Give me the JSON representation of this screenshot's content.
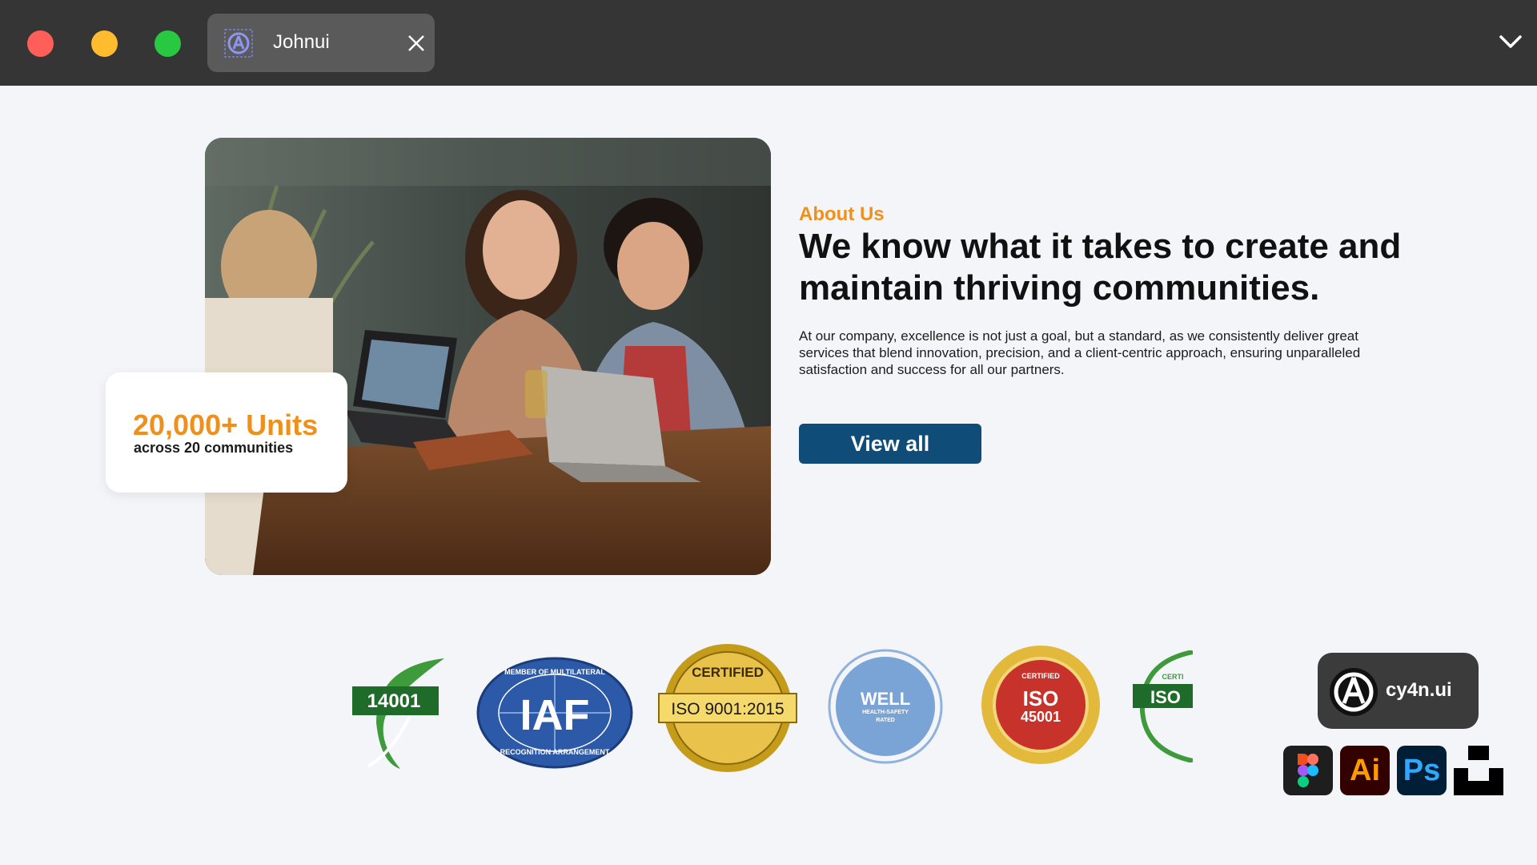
{
  "window": {
    "tab_title": "Johnui",
    "icons": [
      "app-logo-icon",
      "close-icon",
      "chevron-down-icon"
    ]
  },
  "hero": {
    "stat_value": "20,000+ Units",
    "stat_label": "across 20 communities"
  },
  "about": {
    "eyebrow": "About Us",
    "headline": "We know what it takes to create and maintain thriving communities.",
    "body": "At our company, excellence is not just a goal, but a standard, as we consistently deliver great services that blend innovation, precision, and a client-centric approach, ensuring unparalleled satisfaction and success for all our partners.",
    "cta_label": "View all"
  },
  "badges": {
    "iso14001": "14001",
    "iaf_main": "IAF",
    "iaf_top": "MEMBER OF MULTILATERAL",
    "iaf_bottom": "RECOGNITION ARRANGEMENT",
    "iso9001": "ISO 9001:2015",
    "iso9001_certified": "CERTIFIED",
    "well_main": "WELL",
    "well_sub1": "HEALTH-SAFETY",
    "well_sub2": "RATED",
    "iso45001_line1": "ISO",
    "iso45001_line2": "45001",
    "iso45001_certified": "CERTIFIED",
    "partial_iso": "ISO",
    "partial_cert": "CERTI"
  },
  "brand": {
    "name": "cy4n.ui",
    "tools": {
      "illustrator": "Ai",
      "photoshop": "Ps"
    }
  },
  "colors": {
    "accent_orange": "#f0901c",
    "button_blue": "#0f4c78",
    "chrome_dark": "#353535",
    "page_bg": "#f3f5f9"
  }
}
